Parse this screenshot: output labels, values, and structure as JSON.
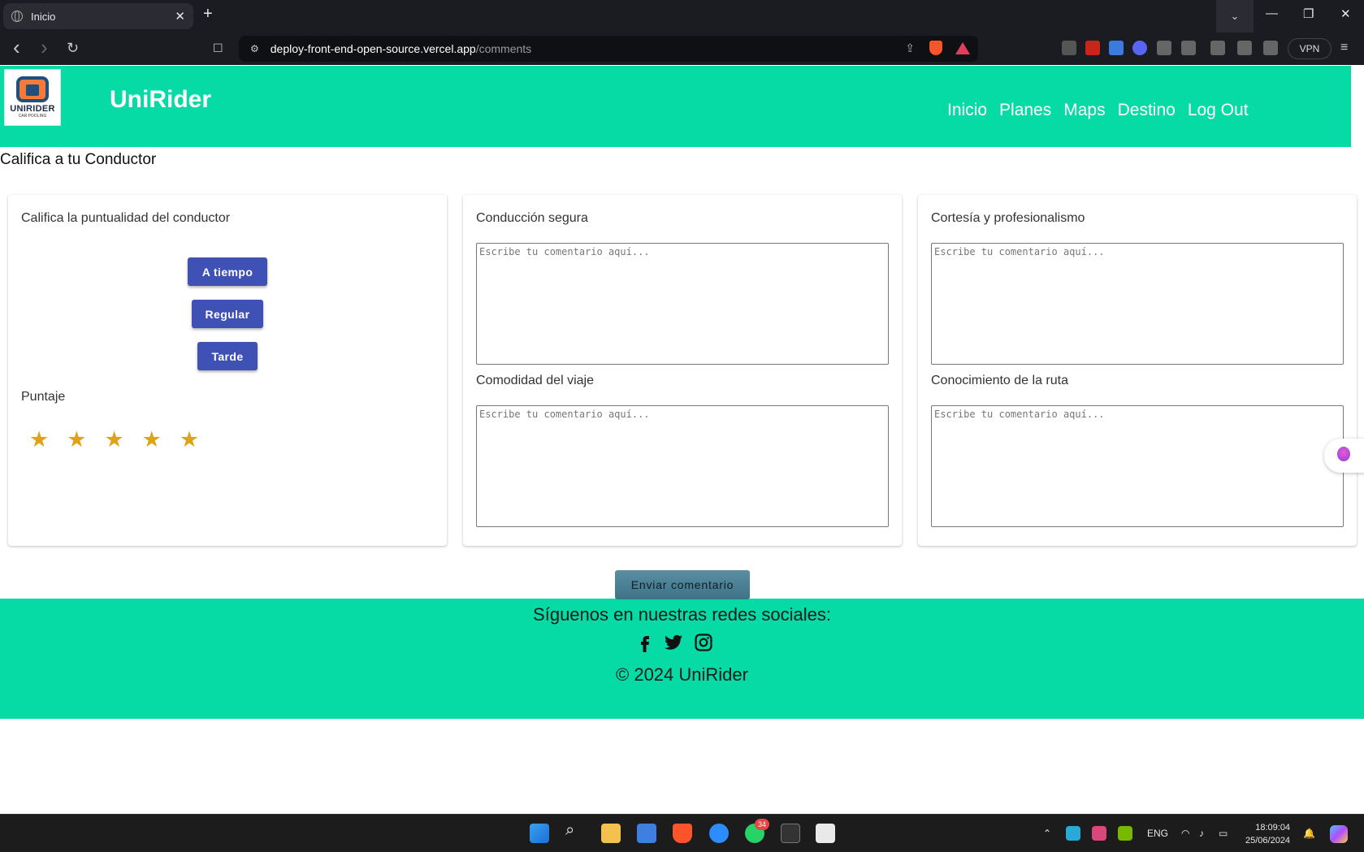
{
  "browser": {
    "tab_title": "Inicio",
    "tab_close": "✕",
    "new_tab": "+",
    "url_host": "deploy-front-end-open-source.vercel.app",
    "url_path": "/comments",
    "vpn_label": "VPN",
    "tab_search": "⌄",
    "minimize": "—",
    "restore": "❐",
    "close": "✕",
    "back": "‹",
    "forward": "›",
    "reload": "↻",
    "bookmark": "☐",
    "share": "⇪"
  },
  "header": {
    "brand": "UniRider",
    "logo_text": "UNIRIDER",
    "logo_subtext": "CAR POOLING",
    "nav": [
      "Inicio",
      "Planes",
      "Maps",
      "Destino",
      "Log Out"
    ]
  },
  "page": {
    "title": "Califica a tu Conductor"
  },
  "card_punctuality": {
    "label": "Califica la puntualidad del conductor",
    "buttons": [
      "A tiempo",
      "Regular",
      "Tarde"
    ],
    "score_label": "Puntaje",
    "stars": 5,
    "star_color": "#e0a313"
  },
  "card_middle": {
    "label_top": "Conducción segura",
    "label_bottom": "Comodidad del viaje",
    "placeholder": "Escribe tu comentario aquí..."
  },
  "card_right": {
    "label_top": "Cortesía y profesionalismo",
    "label_bottom": "Conocimiento de la ruta",
    "placeholder": "Escribe tu comentario aquí..."
  },
  "submit_label": "Enviar comentario",
  "footer": {
    "follow_text": "Síguenos en nuestras redes sociales:",
    "social": [
      "facebook-icon",
      "twitter-icon",
      "instagram-icon"
    ],
    "copyright": "© 2024 UniRider"
  },
  "taskbar": {
    "whatsapp_badge": "34",
    "lang": "ENG",
    "time": "18:09:04",
    "date": "25/06/2024"
  },
  "colors": {
    "accent_green": "#06dba5",
    "button_blue": "#3f51b5",
    "submit_teal": "#4a7f94"
  }
}
